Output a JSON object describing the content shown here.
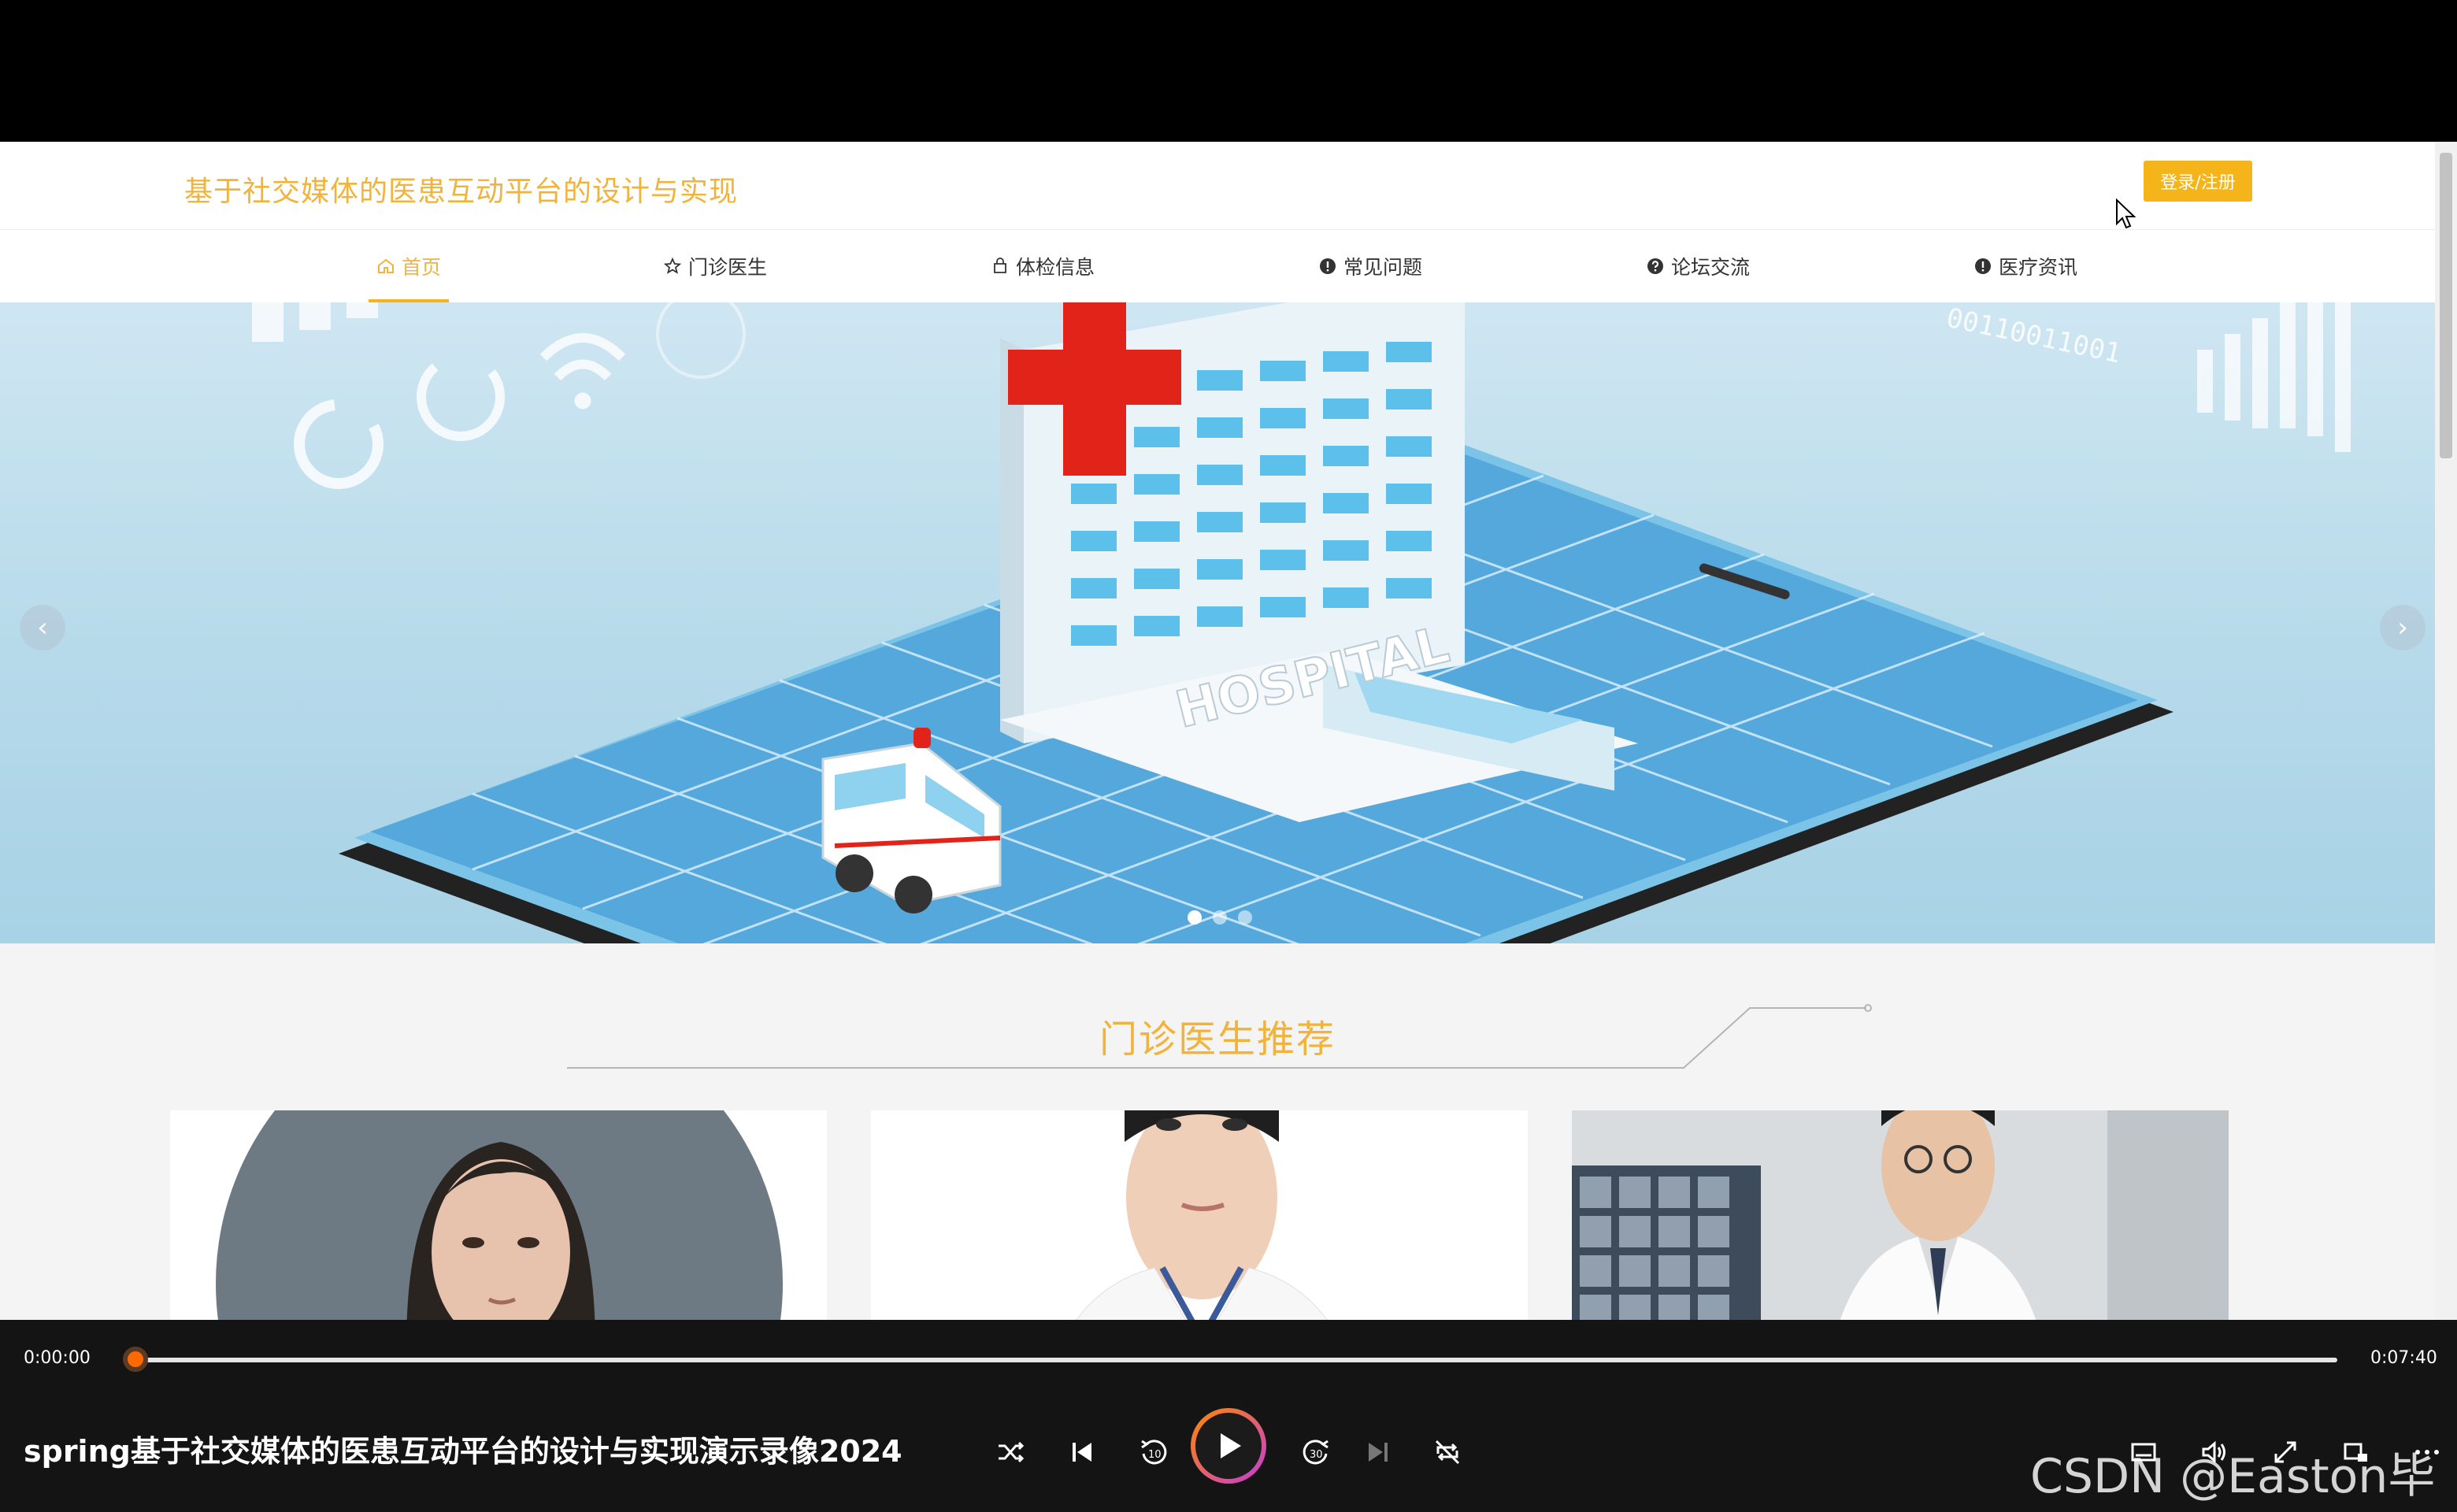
{
  "site": {
    "title": "基于社交媒体的医患互动平台的设计与实现",
    "login_label": "登录/注册"
  },
  "nav": {
    "items": [
      {
        "label": "首页",
        "icon": "home-icon",
        "active": true
      },
      {
        "label": "门诊医生",
        "icon": "star-icon",
        "active": false
      },
      {
        "label": "体检信息",
        "icon": "bag-icon",
        "active": false
      },
      {
        "label": "常见问题",
        "icon": "info-circle-icon",
        "active": false
      },
      {
        "label": "论坛交流",
        "icon": "question-circle-icon",
        "active": false
      },
      {
        "label": "医疗资讯",
        "icon": "info-circle-icon",
        "active": false
      }
    ]
  },
  "banner": {
    "prev_glyph": "‹",
    "next_glyph": "›",
    "hospital_text": "HOSPITAL",
    "binary_text": "00110011001",
    "slides": 3,
    "active_slide": 1
  },
  "section": {
    "title": "门诊医生推荐"
  },
  "player": {
    "time_current": "0:00:00",
    "time_total": "0:07:40",
    "progress_fraction": 0.0,
    "title": "spring基于社交媒体的医患互动平台的设计与实现演示录像2024",
    "watermark": "CSDN @Easton毕设"
  },
  "colors": {
    "accent": "#f1b33c",
    "login_bg": "#f5b51a",
    "player_bg": "#141414",
    "progress": "#ff7a1a"
  }
}
